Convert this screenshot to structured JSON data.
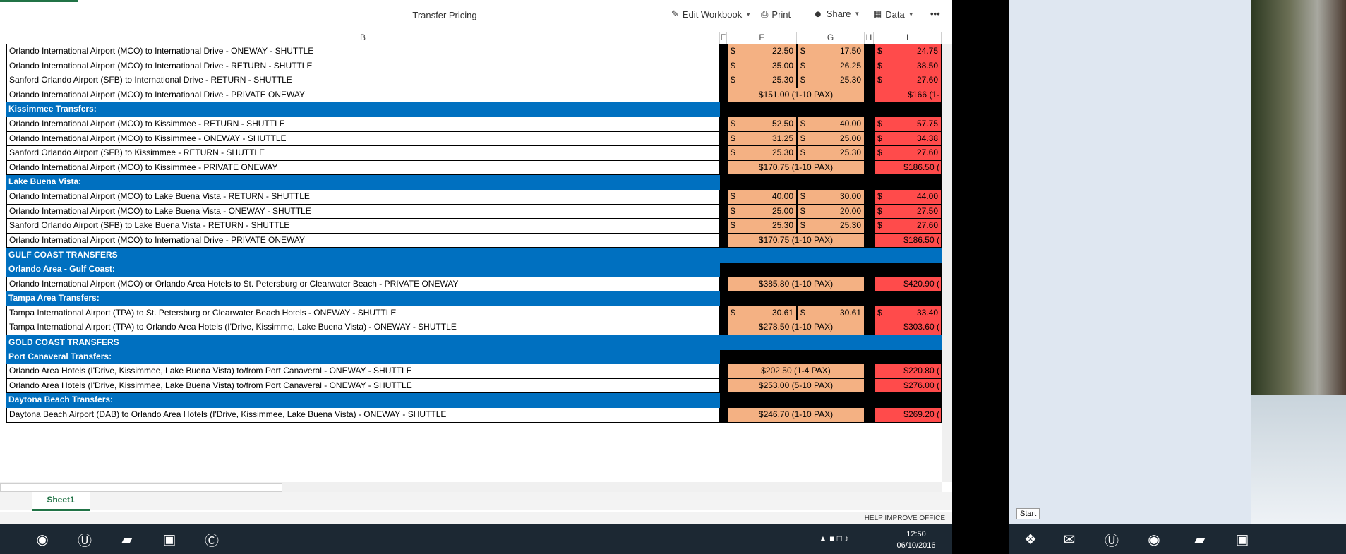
{
  "toolbar": {
    "title": "Transfer Pricing",
    "edit_workbook": "Edit Workbook",
    "print": "Print",
    "share": "Share",
    "data": "Data",
    "more": "•••"
  },
  "columns": {
    "B": "B",
    "E": "E",
    "F": "F",
    "G": "G",
    "H": "H",
    "I": "I"
  },
  "rows": [
    {
      "type": "item",
      "label": "Orlando International Airport (MCO) to International Drive - ONEWAY - SHUTTLE",
      "f": "22.50",
      "g": "17.50",
      "i": "24.75"
    },
    {
      "type": "item",
      "label": "Orlando International Airport (MCO) to International Drive - RETURN - SHUTTLE",
      "f": "35.00",
      "g": "26.25",
      "i": "38.50"
    },
    {
      "type": "item",
      "label": "Sanford Orlando Airport (SFB) to International Drive - RETURN - SHUTTLE",
      "f": "25.30",
      "g": "25.30",
      "i": "27.60"
    },
    {
      "type": "private",
      "label": "Orlando International Airport (MCO) to International Drive - PRIVATE ONEWAY",
      "fg": "$151.00 (1-10 PAX)",
      "i": "$166 (1-"
    },
    {
      "type": "header",
      "label": "Kissimmee Transfers:"
    },
    {
      "type": "item",
      "label": "Orlando International Airport (MCO) to Kissimmee - RETURN - SHUTTLE",
      "f": "52.50",
      "g": "40.00",
      "i": "57.75"
    },
    {
      "type": "item",
      "label": "Orlando International Airport (MCO) to Kissimmee - ONEWAY - SHUTTLE",
      "f": "31.25",
      "g": "25.00",
      "i": "34.38"
    },
    {
      "type": "item",
      "label": "Sanford Orlando Airport (SFB) to Kissimmee - RETURN - SHUTTLE",
      "f": "25.30",
      "g": "25.30",
      "i": "27.60"
    },
    {
      "type": "private",
      "label": "Orlando International Airport (MCO) to Kissimmee - PRIVATE ONEWAY",
      "fg": "$170.75 (1-10 PAX)",
      "i": "$186.50 ("
    },
    {
      "type": "header",
      "label": "Lake Buena Vista:"
    },
    {
      "type": "item",
      "label": "Orlando International Airport (MCO) to Lake Buena Vista - RETURN - SHUTTLE",
      "f": "40.00",
      "g": "30.00",
      "i": "44.00"
    },
    {
      "type": "item",
      "label": "Orlando International Airport (MCO) to Lake Buena Vista - ONEWAY - SHUTTLE",
      "f": "25.00",
      "g": "20.00",
      "i": "27.50"
    },
    {
      "type": "item",
      "label": "Sanford Orlando Airport (SFB) to Lake Buena Vista - RETURN - SHUTTLE",
      "f": "25.30",
      "g": "25.30",
      "i": "27.60"
    },
    {
      "type": "private",
      "label": "Orlando International Airport (MCO) to International Drive - PRIVATE ONEWAY",
      "fg": "$170.75 (1-10 PAX)",
      "i": "$186.50 ("
    },
    {
      "type": "section",
      "label": "GULF COAST TRANSFERS"
    },
    {
      "type": "header",
      "label": "Orlando Area - Gulf Coast:"
    },
    {
      "type": "private",
      "label": "Orlando International Airport (MCO) or Orlando Area Hotels to St. Petersburg or Clearwater Beach - PRIVATE ONEWAY",
      "fg": "$385.80 (1-10 PAX)",
      "i": "$420.90 ("
    },
    {
      "type": "header",
      "label": "Tampa Area Transfers:"
    },
    {
      "type": "item",
      "label": "Tampa International Airport (TPA) to St. Petersburg or Clearwater Beach Hotels - ONEWAY - SHUTTLE",
      "f": "30.61",
      "g": "30.61",
      "i": "33.40"
    },
    {
      "type": "private",
      "label": "Tampa International Airport (TPA) to Orlando Area Hotels (I'Drive, Kissimme, Lake Buena Vista) - ONEWAY - SHUTTLE",
      "fg": "$278.50 (1-10 PAX)",
      "i": "$303.60 ("
    },
    {
      "type": "section",
      "label": "GOLD COAST TRANSFERS"
    },
    {
      "type": "header",
      "label": "Port Canaveral Transfers:"
    },
    {
      "type": "private",
      "label": "Orlando Area Hotels (I'Drive, Kissimmee, Lake Buena Vista) to/from Port Canaveral - ONEWAY - SHUTTLE",
      "fg": "$202.50 (1-4 PAX)",
      "i": "$220.80 ("
    },
    {
      "type": "private",
      "label": "Orlando Area Hotels (I'Drive, Kissimmee, Lake Buena Vista) to/from Port Canaveral - ONEWAY - SHUTTLE",
      "fg": "$253.00 (5-10 PAX)",
      "i": "$276.00 ("
    },
    {
      "type": "header",
      "label": "Daytona Beach Transfers:"
    },
    {
      "type": "private",
      "label": "Daytona Beach Airport (DAB) to Orlando Area Hotels (I'Drive, Kissimmee, Lake Buena Vista) - ONEWAY - SHUTTLE",
      "fg": "$246.70 (1-10 PAX)",
      "i": "$269.20 ("
    }
  ],
  "currency": "$",
  "sheet_tab": "Sheet1",
  "status": {
    "help": "HELP IMPROVE OFFICE"
  },
  "taskbar": {
    "time": "12:50",
    "date": "06/10/2016"
  },
  "start_tooltip": "Start"
}
